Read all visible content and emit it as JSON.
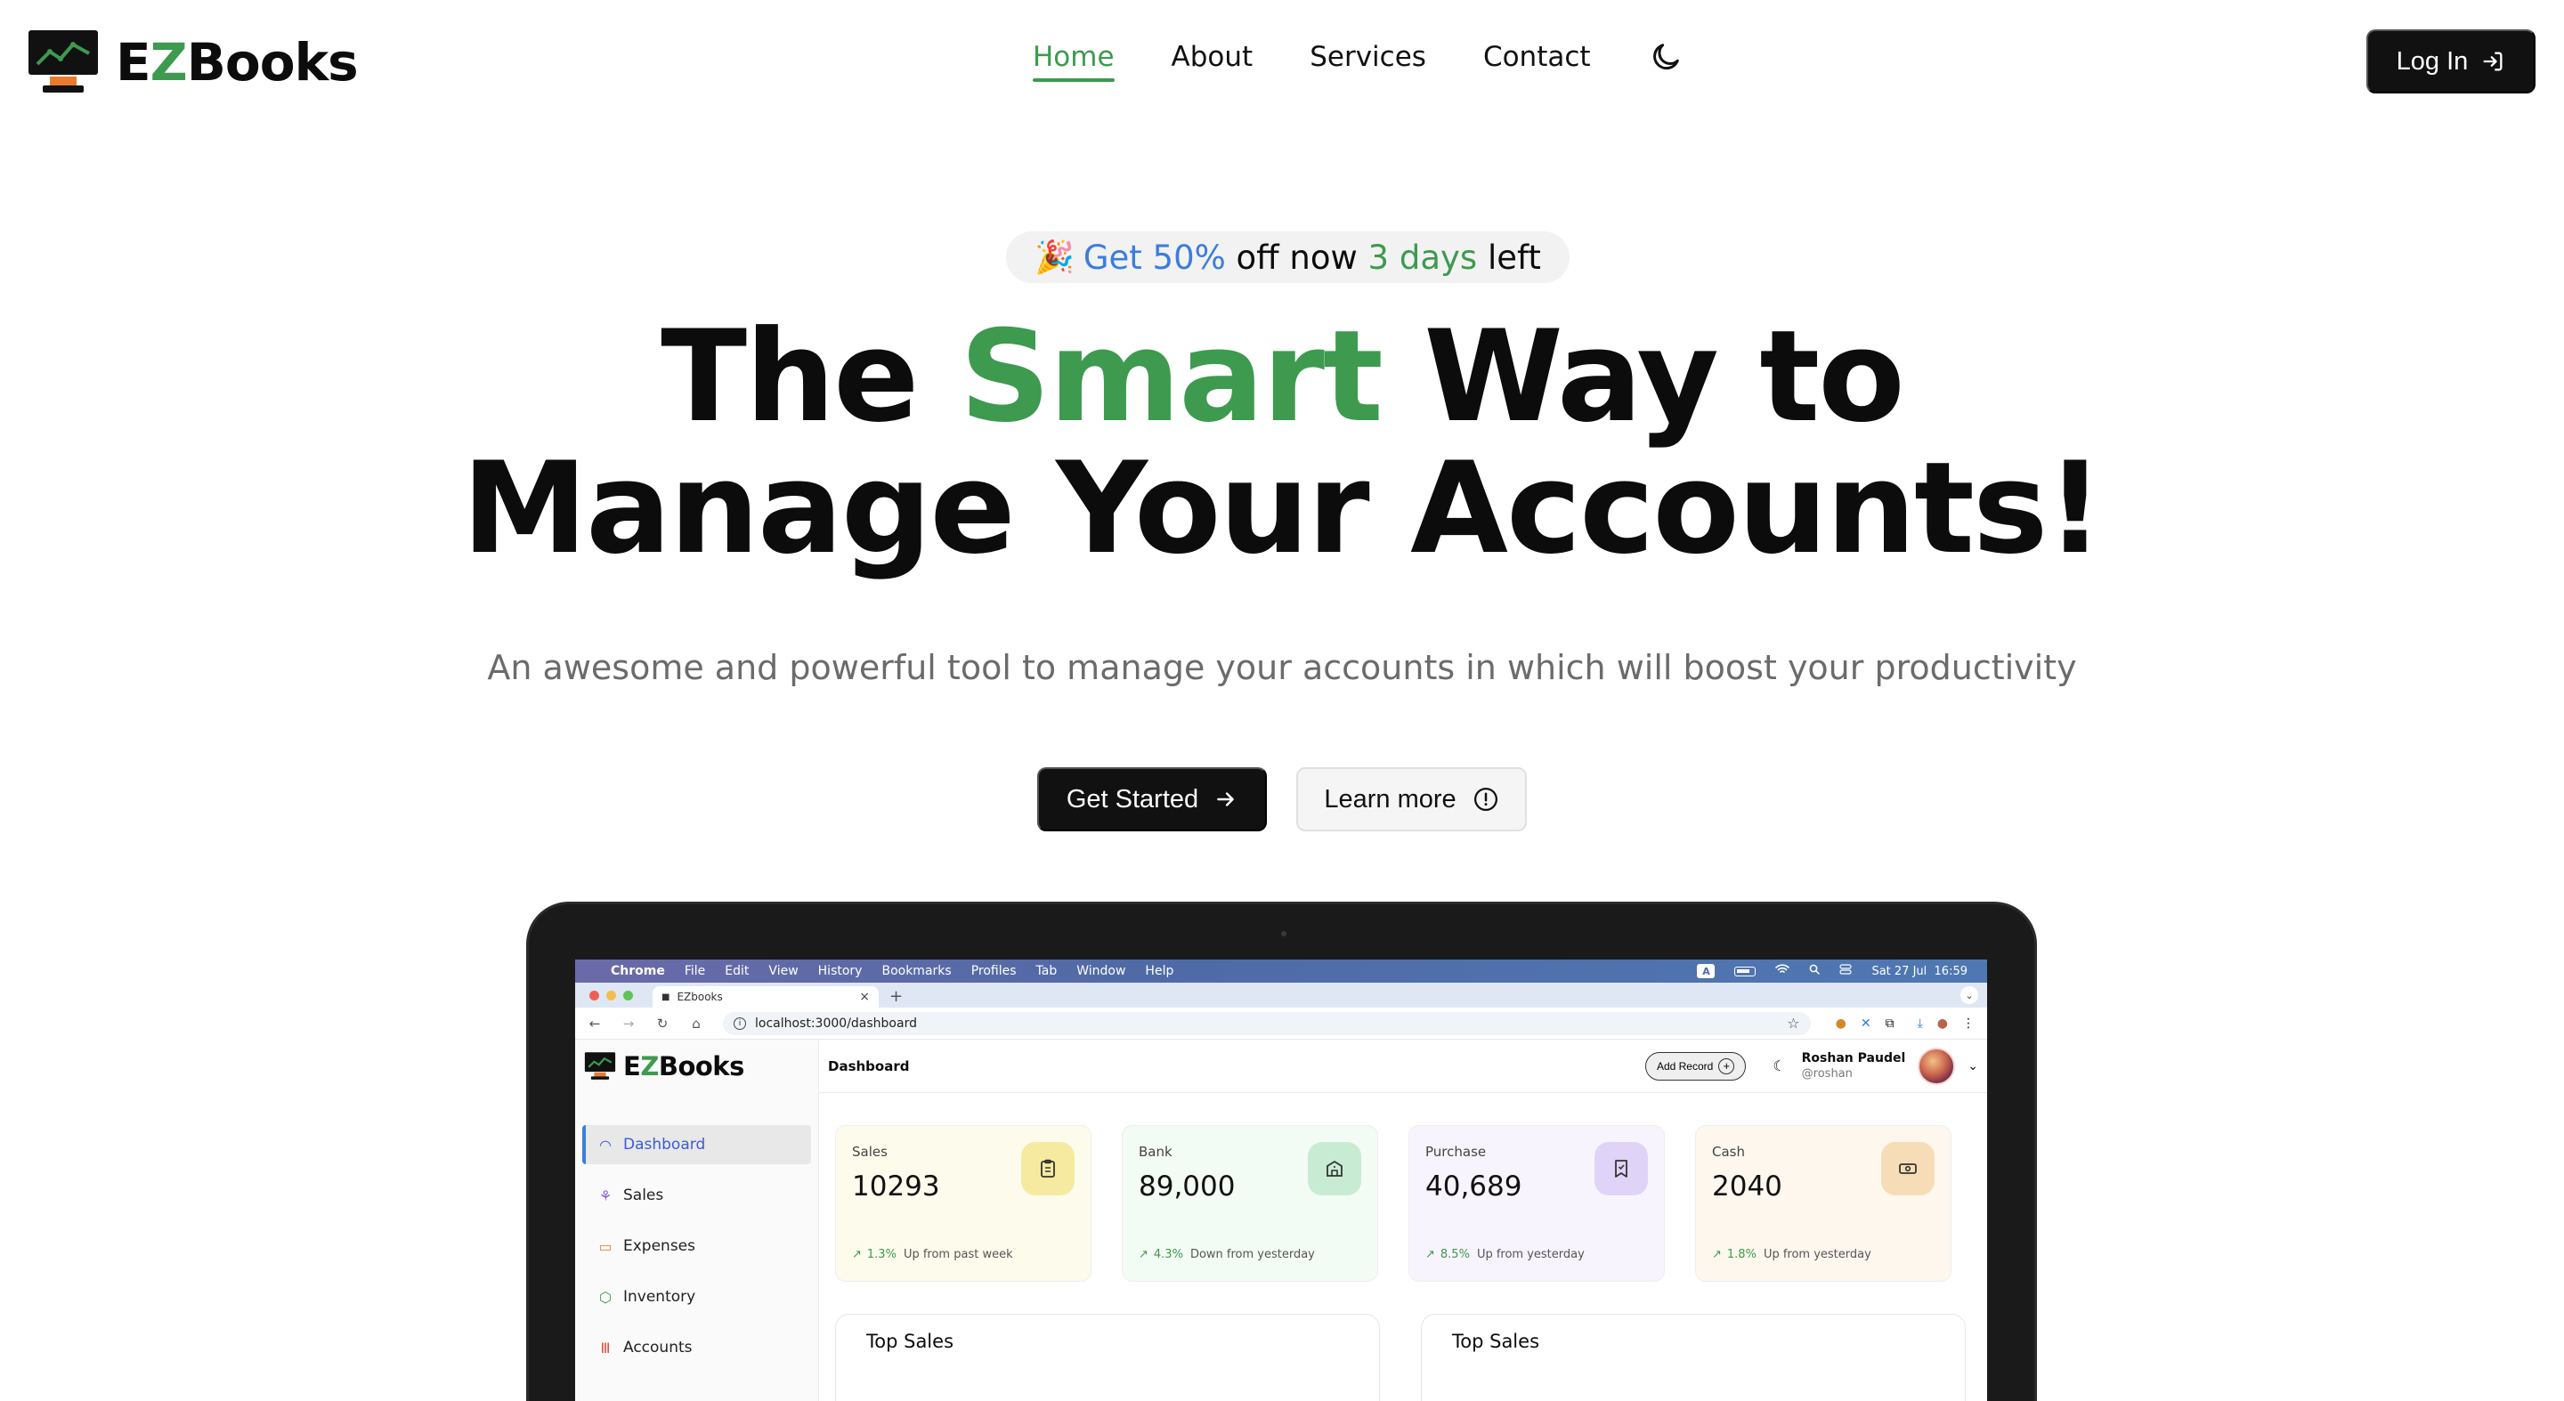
{
  "brand": {
    "name_prefix": "E",
    "name_accent": "Z",
    "name_suffix": "Books"
  },
  "nav": {
    "links": [
      "Home",
      "About",
      "Services",
      "Contact"
    ],
    "active": "Home",
    "login_label": "Log In"
  },
  "hero": {
    "promo": {
      "emoji": "🎉",
      "part1": "Get 50%",
      "part2": " off now ",
      "part3": "3 days",
      "part4": " left"
    },
    "headline": {
      "line1_a": "The ",
      "line1_accent": "Smart",
      "line1_b": " Way to",
      "line2": "Manage Your Accounts!"
    },
    "subtitle": "An awesome and powerful tool to manage your accounts in which will boost your productivity",
    "primary_button": "Get Started",
    "secondary_button": "Learn more"
  },
  "mockup": {
    "mac_menu": [
      "Chrome",
      "File",
      "Edit",
      "View",
      "History",
      "Bookmarks",
      "Profiles",
      "Tab",
      "Window",
      "Help"
    ],
    "mac_status": {
      "input_badge": "A",
      "datetime": "Sat 27 Jul  16:59"
    },
    "browser": {
      "tab_title": "EZbooks",
      "url": "localhost:3000/dashboard"
    },
    "app": {
      "brand": {
        "name_prefix": "E",
        "name_accent": "Z",
        "name_suffix": "Books"
      },
      "page_title": "Dashboard",
      "add_record": "Add Record",
      "user": {
        "name": "Roshan Paudel",
        "handle": "@roshan"
      },
      "sidebar": [
        {
          "label": "Dashboard",
          "icon": "gauge-icon",
          "active": true
        },
        {
          "label": "Sales",
          "icon": "sales-icon",
          "active": false
        },
        {
          "label": "Expenses",
          "icon": "wallet-icon",
          "active": false
        },
        {
          "label": "Inventory",
          "icon": "box-icon",
          "active": false
        },
        {
          "label": "Accounts",
          "icon": "books-icon",
          "active": false
        }
      ],
      "cards": [
        {
          "label": "Sales",
          "value": "10293",
          "pct": "1.3%",
          "note": "Up from past week",
          "bg": "#fdfbec",
          "icon_bg": "#f6eaa0",
          "icon": "clipboard-icon"
        },
        {
          "label": "Bank",
          "value": "89,000",
          "pct": "4.3%",
          "note": "Down from yesterday",
          "bg": "#f3fbf5",
          "icon_bg": "#c8ecd3",
          "icon": "bank-icon"
        },
        {
          "label": "Purchase",
          "value": "40,689",
          "pct": "8.5%",
          "note": "Up from yesterday",
          "bg": "#f7f4fd",
          "icon_bg": "#dfd4f7",
          "icon": "receipt-icon"
        },
        {
          "label": "Cash",
          "value": "2040",
          "pct": "1.8%",
          "note": "Up from yesterday",
          "bg": "#fdf7ee",
          "icon_bg": "#f6ddb8",
          "icon": "cash-icon"
        }
      ],
      "panels": [
        "Top Sales",
        "Top Sales"
      ]
    }
  },
  "colors": {
    "accent_green": "#3d9a4f",
    "accent_blue": "#3b7ddd",
    "dark": "#111111"
  }
}
